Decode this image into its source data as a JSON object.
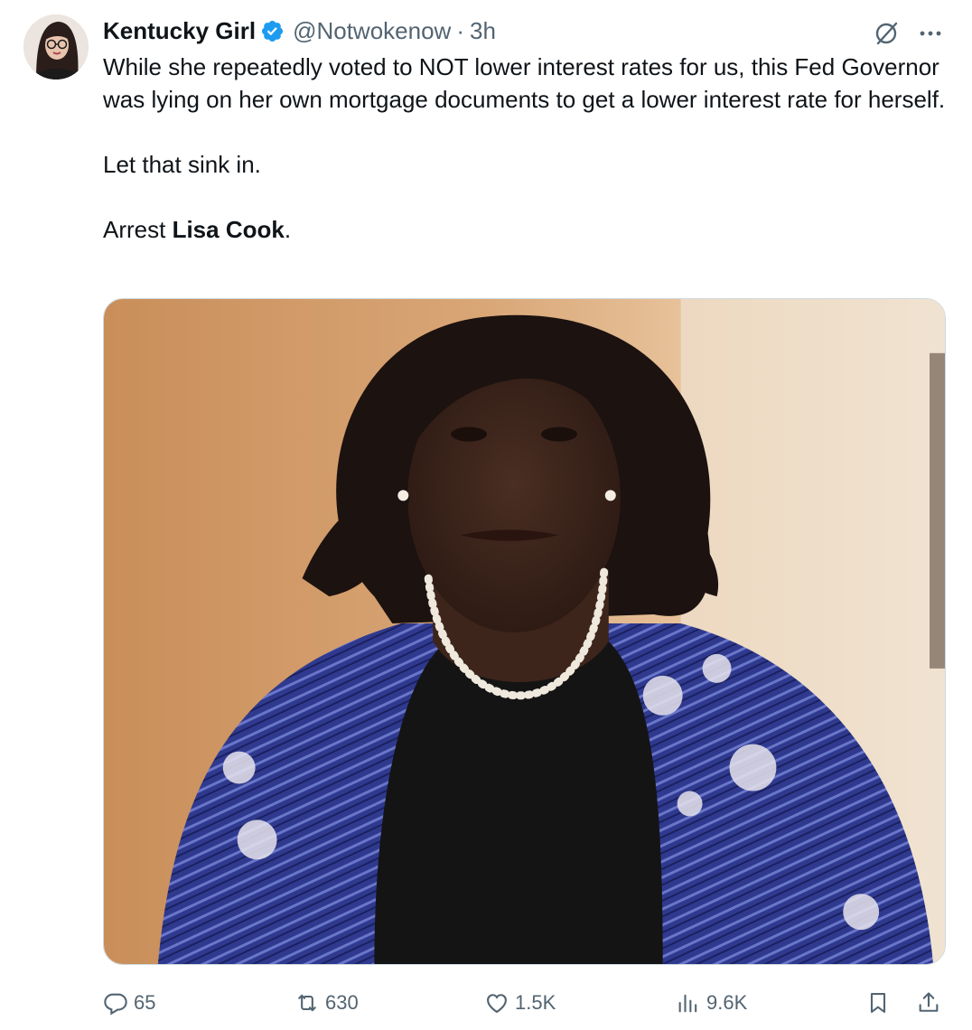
{
  "author": {
    "name": "Kentucky Girl",
    "handle": "@Notwokenow",
    "separator": "·",
    "time": "3h",
    "verified": true
  },
  "tweet": {
    "line1": "While she repeatedly voted to NOT lower interest rates for us, this Fed Governor was lying on her own mortgage documents to get a lower interest rate for herself.",
    "line2": "Let that sink in.",
    "line3_prefix": "Arrest ",
    "line3_bold": "Lisa Cook",
    "line3_suffix": "."
  },
  "actions": {
    "replies": "65",
    "reposts": "630",
    "likes": "1.5K",
    "views": "9.6K"
  },
  "icons": {
    "verified": "verified-badge-icon",
    "grok": "grok-icon",
    "more": "more-dots-icon",
    "reply": "reply-bubble-icon",
    "repost": "repost-arrows-icon",
    "like": "heart-icon",
    "views": "bar-chart-icon",
    "bookmark": "bookmark-icon",
    "share": "share-upload-icon"
  },
  "colors": {
    "text": "#0f1419",
    "secondary": "#536471",
    "verified": "#1d9bf0"
  }
}
